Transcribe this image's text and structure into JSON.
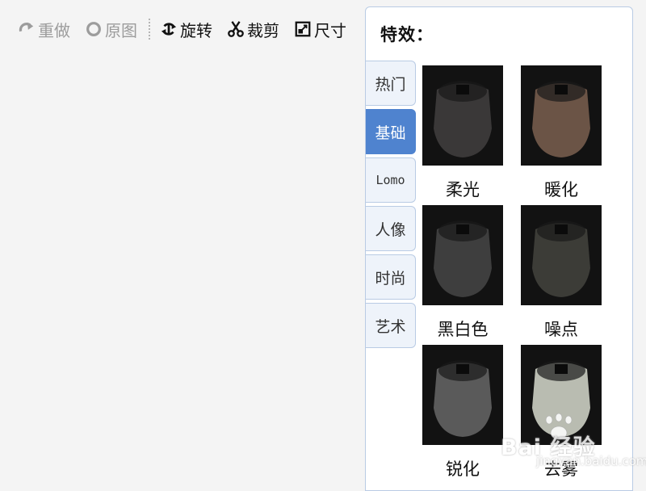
{
  "toolbar": {
    "redo_label": "重做",
    "original_label": "原图",
    "rotate_label": "旋转",
    "crop_label": "裁剪",
    "size_label": "尺寸"
  },
  "panel": {
    "title": "特效：",
    "tabs": [
      {
        "label": "热门"
      },
      {
        "label": "基础",
        "active": true
      },
      {
        "label": "Lomo"
      },
      {
        "label": "人像"
      },
      {
        "label": "时尚"
      },
      {
        "label": "艺术"
      }
    ],
    "effects": [
      {
        "label": "柔光",
        "tint": "#3a3838"
      },
      {
        "label": "暖化",
        "tint": "#6b5446"
      },
      {
        "label": "黑白色",
        "tint": "#3e3e3e"
      },
      {
        "label": "噪点",
        "tint": "#3c3c37"
      },
      {
        "label": "锐化",
        "tint": "#5a5a5a"
      },
      {
        "label": "去雾",
        "tint": "#b9bcb1"
      }
    ]
  },
  "watermark": {
    "brand": "Bai 经验",
    "url": "jingyan.baidu.com"
  }
}
